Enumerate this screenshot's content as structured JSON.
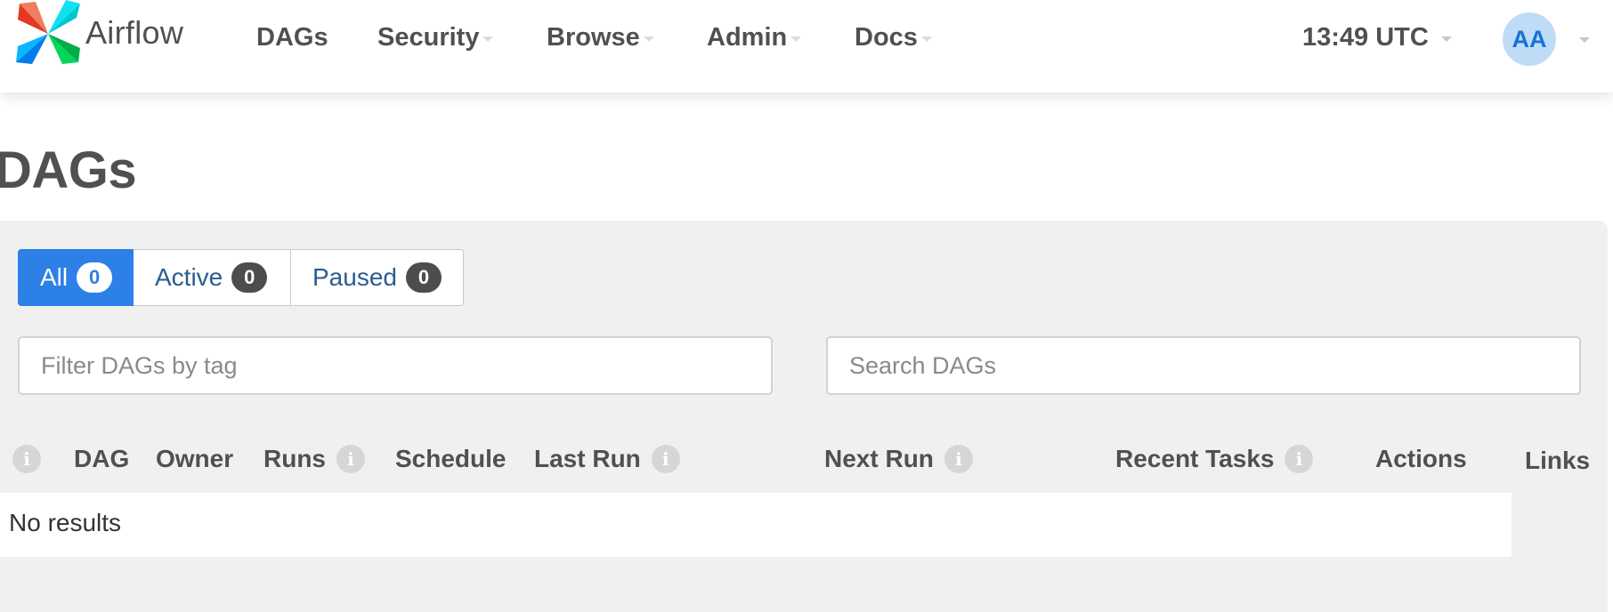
{
  "brand": {
    "name": "Airflow"
  },
  "nav": {
    "items": [
      {
        "label": "DAGs",
        "dropdown": false
      },
      {
        "label": "Security",
        "dropdown": true
      },
      {
        "label": "Browse",
        "dropdown": true
      },
      {
        "label": "Admin",
        "dropdown": true
      },
      {
        "label": "Docs",
        "dropdown": true
      }
    ],
    "clock": "13:49 UTC",
    "user_initials": "AA"
  },
  "page": {
    "title": "DAGs"
  },
  "filters": {
    "all": {
      "label": "All",
      "count": "0"
    },
    "active": {
      "label": "Active",
      "count": "0"
    },
    "paused": {
      "label": "Paused",
      "count": "0"
    }
  },
  "inputs": {
    "tag_filter_placeholder": "Filter DAGs by tag",
    "search_placeholder": "Search DAGs"
  },
  "table": {
    "headers": {
      "dag": "DAG",
      "owner": "Owner",
      "runs": "Runs",
      "schedule": "Schedule",
      "last_run": "Last Run",
      "next_run": "Next Run",
      "recent_tasks": "Recent Tasks",
      "actions": "Actions",
      "links": "Links"
    },
    "empty_message": "No results"
  },
  "icons": {
    "info": "info-icon",
    "caret": "caret-down-icon",
    "logo": "airflow-pinwheel-icon"
  },
  "colors": {
    "primary": "#2d80e6",
    "badge_dark": "#4d4d4d",
    "panel_bg": "#f0f0f0",
    "text": "#51504f"
  }
}
